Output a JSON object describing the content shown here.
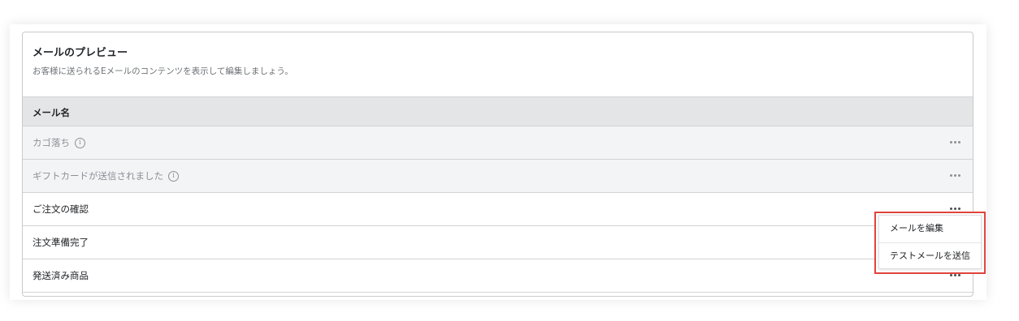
{
  "card": {
    "title": "メールのプレビュー",
    "subtitle": "お客様に送られるEメールのコンテンツを表示して編集しましょう。"
  },
  "table": {
    "column_header": "メール名",
    "rows": [
      {
        "label": "カゴ落ち",
        "disabled": true,
        "info_icon": "ⓘ"
      },
      {
        "label": "ギフトカードが送信されました",
        "disabled": true,
        "info_icon": "ⓘ"
      },
      {
        "label": "ご注文の確認",
        "disabled": false
      },
      {
        "label": "注文準備完了",
        "disabled": false
      },
      {
        "label": "発送済み商品",
        "disabled": false
      }
    ]
  },
  "menu": {
    "items": [
      {
        "label": "メールを編集"
      },
      {
        "label": "テストメールを送信"
      }
    ],
    "highlight_color": "#e0443c"
  },
  "icons": {
    "info": "info-icon",
    "more": "more-horizontal-icon"
  }
}
